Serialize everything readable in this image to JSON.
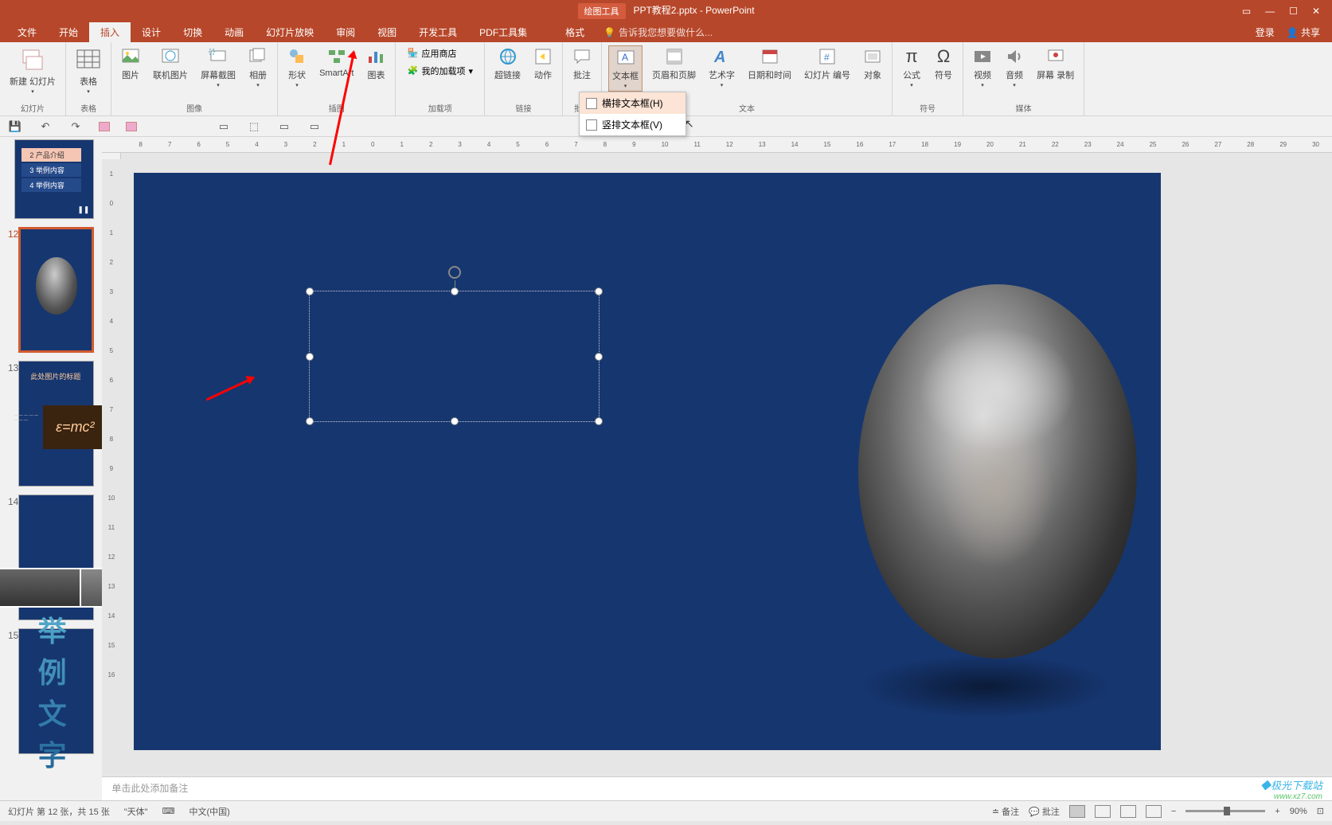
{
  "titlebar": {
    "context_tab": "绘图工具",
    "filename": "PPT教程2.pptx - PowerPoint"
  },
  "menu": {
    "tabs": [
      "文件",
      "开始",
      "插入",
      "设计",
      "切换",
      "动画",
      "幻灯片放映",
      "审阅",
      "视图",
      "开发工具",
      "PDF工具集",
      "格式"
    ],
    "active_index": 2,
    "tell_me": "告诉我您想要做什么...",
    "login": "登录",
    "share": "共享"
  },
  "ribbon": {
    "groups": [
      {
        "label": "幻灯片",
        "items": [
          {
            "name": "新建\n幻灯片",
            "key": "new-slide"
          }
        ]
      },
      {
        "label": "表格",
        "items": [
          {
            "name": "表格",
            "key": "table"
          }
        ]
      },
      {
        "label": "图像",
        "items": [
          {
            "name": "图片",
            "key": "picture"
          },
          {
            "name": "联机图片",
            "key": "online-picture"
          },
          {
            "name": "屏幕截图",
            "key": "screenshot"
          },
          {
            "name": "相册",
            "key": "album"
          }
        ]
      },
      {
        "label": "插图",
        "items": [
          {
            "name": "形状",
            "key": "shapes"
          },
          {
            "name": "SmartArt",
            "key": "smartart"
          },
          {
            "name": "图表",
            "key": "chart"
          }
        ]
      },
      {
        "label": "加载项",
        "items_stacked": [
          {
            "name": "应用商店",
            "key": "store"
          },
          {
            "name": "我的加载项",
            "key": "addins"
          }
        ]
      },
      {
        "label": "链接",
        "items": [
          {
            "name": "超链接",
            "key": "hyperlink"
          },
          {
            "name": "动作",
            "key": "action"
          }
        ]
      },
      {
        "label": "批注",
        "items": [
          {
            "name": "批注",
            "key": "comment"
          }
        ]
      },
      {
        "label": "文本",
        "items": [
          {
            "name": "文本框",
            "key": "textbox",
            "active": true
          },
          {
            "name": "页眉和页脚",
            "key": "header-footer"
          },
          {
            "name": "艺术字",
            "key": "wordart"
          },
          {
            "name": "日期和时间",
            "key": "datetime"
          },
          {
            "name": "幻灯片\n编号",
            "key": "slide-number"
          },
          {
            "name": "对象",
            "key": "object"
          }
        ]
      },
      {
        "label": "符号",
        "items": [
          {
            "name": "公式",
            "key": "equation"
          },
          {
            "name": "符号",
            "key": "symbol"
          }
        ]
      },
      {
        "label": "媒体",
        "items": [
          {
            "name": "视频",
            "key": "video"
          },
          {
            "name": "音频",
            "key": "audio"
          },
          {
            "name": "屏幕\n录制",
            "key": "screen-recording"
          }
        ]
      }
    ]
  },
  "dropdown": {
    "items": [
      {
        "label": "横排文本框(H)",
        "key": "horizontal-textbox"
      },
      {
        "label": "竖排文本框(V)",
        "key": "vertical-textbox"
      }
    ]
  },
  "thumbs": {
    "slides": [
      {
        "num": "",
        "toc": [
          "2 产品介绍",
          "3 举例内容",
          "4 举例内容"
        ]
      },
      {
        "num": "12",
        "selected": true,
        "portrait": true
      },
      {
        "num": "13",
        "title": "此处图片的标题",
        "formula": "ε=mc²"
      },
      {
        "num": "14",
        "photos": true
      },
      {
        "num": "15",
        "bigtext": "举例文字"
      }
    ]
  },
  "ruler": {
    "h": [
      "8",
      "7",
      "6",
      "5",
      "4",
      "3",
      "2",
      "1",
      "0",
      "1",
      "2",
      "3",
      "4",
      "5",
      "6",
      "7",
      "8",
      "9",
      "10",
      "11",
      "12",
      "13",
      "14",
      "15",
      "16",
      "17",
      "18",
      "19",
      "20",
      "21",
      "22",
      "23",
      "24",
      "25",
      "26",
      "27",
      "28",
      "29",
      "30"
    ],
    "v": [
      "1",
      "0",
      "1",
      "2",
      "3",
      "4",
      "5",
      "6",
      "7",
      "8",
      "9",
      "10",
      "11",
      "12",
      "13",
      "14",
      "15",
      "16"
    ]
  },
  "notes": {
    "placeholder": "单击此处添加备注"
  },
  "status": {
    "slide_info": "幻灯片 第 12 张，共 15 张",
    "theme": "\"天体\"",
    "lang_icon": "⌨",
    "language": "中文(中国)",
    "notes_btn": "备注",
    "comments_btn": "批注",
    "zoom": "90%"
  },
  "watermark": {
    "line1": "◆极光下载站",
    "line2": "www.xz7.com"
  }
}
